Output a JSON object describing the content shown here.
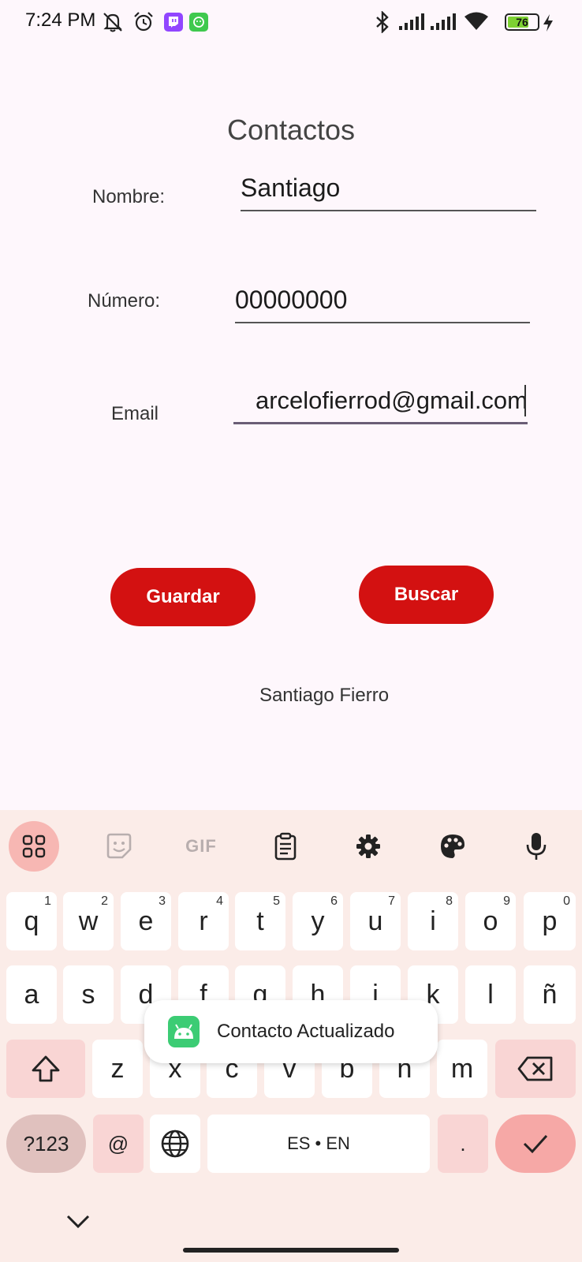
{
  "status_bar": {
    "time": "7:24 PM",
    "icons": [
      "mute-bell-icon",
      "alarm-icon",
      "twitch-app-icon",
      "whatsapp-sticker-app-icon",
      "bluetooth-icon",
      "signal-icon",
      "signal-icon",
      "wifi-icon",
      "battery-icon",
      "charging-icon"
    ],
    "battery_level": "76",
    "battery_percent": 76,
    "colors": {
      "twitch": "#9146ff",
      "sticker_app": "#3fc94e",
      "battery_fill": "#7dd132"
    }
  },
  "form": {
    "title": "Contactos",
    "name_label": "Nombre:",
    "name_value": "Santiago",
    "number_label": "Número:",
    "number_value": "00000000",
    "email_label": "Email",
    "email_value": "arcelofierrod@gmail.com",
    "save_button": "Guardar",
    "search_button": "Buscar",
    "result_text": "Santiago Fierro",
    "accent_color": "#d31111"
  },
  "keyboard": {
    "toolbar": [
      "apps-grid-icon",
      "sticker-icon",
      "GIF",
      "clipboard-icon",
      "settings-gear-icon",
      "palette-icon",
      "microphone-icon"
    ],
    "gif_label": "GIF",
    "row1": [
      {
        "k": "q",
        "s": "1"
      },
      {
        "k": "w",
        "s": "2"
      },
      {
        "k": "e",
        "s": "3"
      },
      {
        "k": "r",
        "s": "4"
      },
      {
        "k": "t",
        "s": "5"
      },
      {
        "k": "y",
        "s": "6"
      },
      {
        "k": "u",
        "s": "7"
      },
      {
        "k": "i",
        "s": "8"
      },
      {
        "k": "o",
        "s": "9"
      },
      {
        "k": "p",
        "s": "0"
      }
    ],
    "row2": [
      "a",
      "s",
      "d",
      "f",
      "g",
      "h",
      "j",
      "k",
      "l",
      "ñ"
    ],
    "row3": [
      "z",
      "x",
      "c",
      "v",
      "b",
      "n",
      "m"
    ],
    "symbols_key": "?123",
    "at_key": "@",
    "space_key": "ES • EN",
    "period_key": ".",
    "toast_text": "Contacto Actualizado"
  }
}
